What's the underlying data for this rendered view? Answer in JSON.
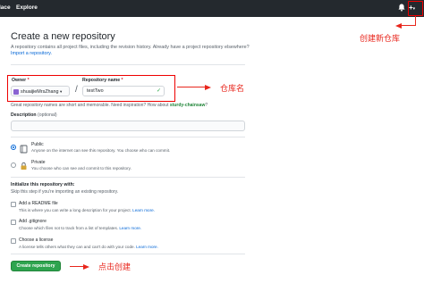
{
  "nav": {
    "item1": "lace",
    "item2": "Explore",
    "bell_icon": "bell-icon",
    "plus_icon": "plus-icon",
    "plus_caret": "▾",
    "avatar_icon": "avatar"
  },
  "page": {
    "title": "Create a new repository",
    "subtitle": "A repository contains all project files, including the revision history. Already have a project repository elsewhere?",
    "import_link": "Import a repository."
  },
  "owner": {
    "label": "Owner",
    "required_mark": "*",
    "value": "shuaijieMrsZhang",
    "caret": "▾"
  },
  "slash": "/",
  "repo_name": {
    "label": "Repository name",
    "required_mark": "*",
    "value": "testTwo",
    "valid_mark": "✓"
  },
  "hint": {
    "text": "Great repository names are short and memorable. Need inspiration? How about",
    "suggestion": "sturdy-chainsaw",
    "suffix": "?"
  },
  "description": {
    "label": "Description",
    "optional": "(optional)",
    "value": ""
  },
  "visibility": {
    "public": {
      "label": "Public",
      "desc": "Anyone on the internet can see this repository. You choose who can commit.",
      "selected": true
    },
    "private": {
      "label": "Private",
      "desc": "You choose who can see and commit to this repository.",
      "selected": false
    }
  },
  "init": {
    "heading": "Initialize this repository with:",
    "desc": "Skip this step if you're importing an existing repository.",
    "readme": {
      "label": "Add a README file",
      "desc": "This is where you can write a long description for your project.",
      "link": "Learn more."
    },
    "gitignore": {
      "label": "Add .gitignore",
      "desc": "Choose which files not to track from a list of templates.",
      "link": "Learn more."
    },
    "license": {
      "label": "Choose a license",
      "desc": "A license tells others what they can and can't do with your code.",
      "link": "Learn more."
    }
  },
  "create_button": "Create repository",
  "annotations": {
    "new_repo": "创建新仓库",
    "repo_name": "仓库名",
    "click_create": "点击创建"
  },
  "colors": {
    "header_bg": "#24292e",
    "accent_link": "#0366d6",
    "primary_button": "#2ea44f",
    "annotation_red": "#e8261c",
    "valid_green": "#28a745"
  }
}
